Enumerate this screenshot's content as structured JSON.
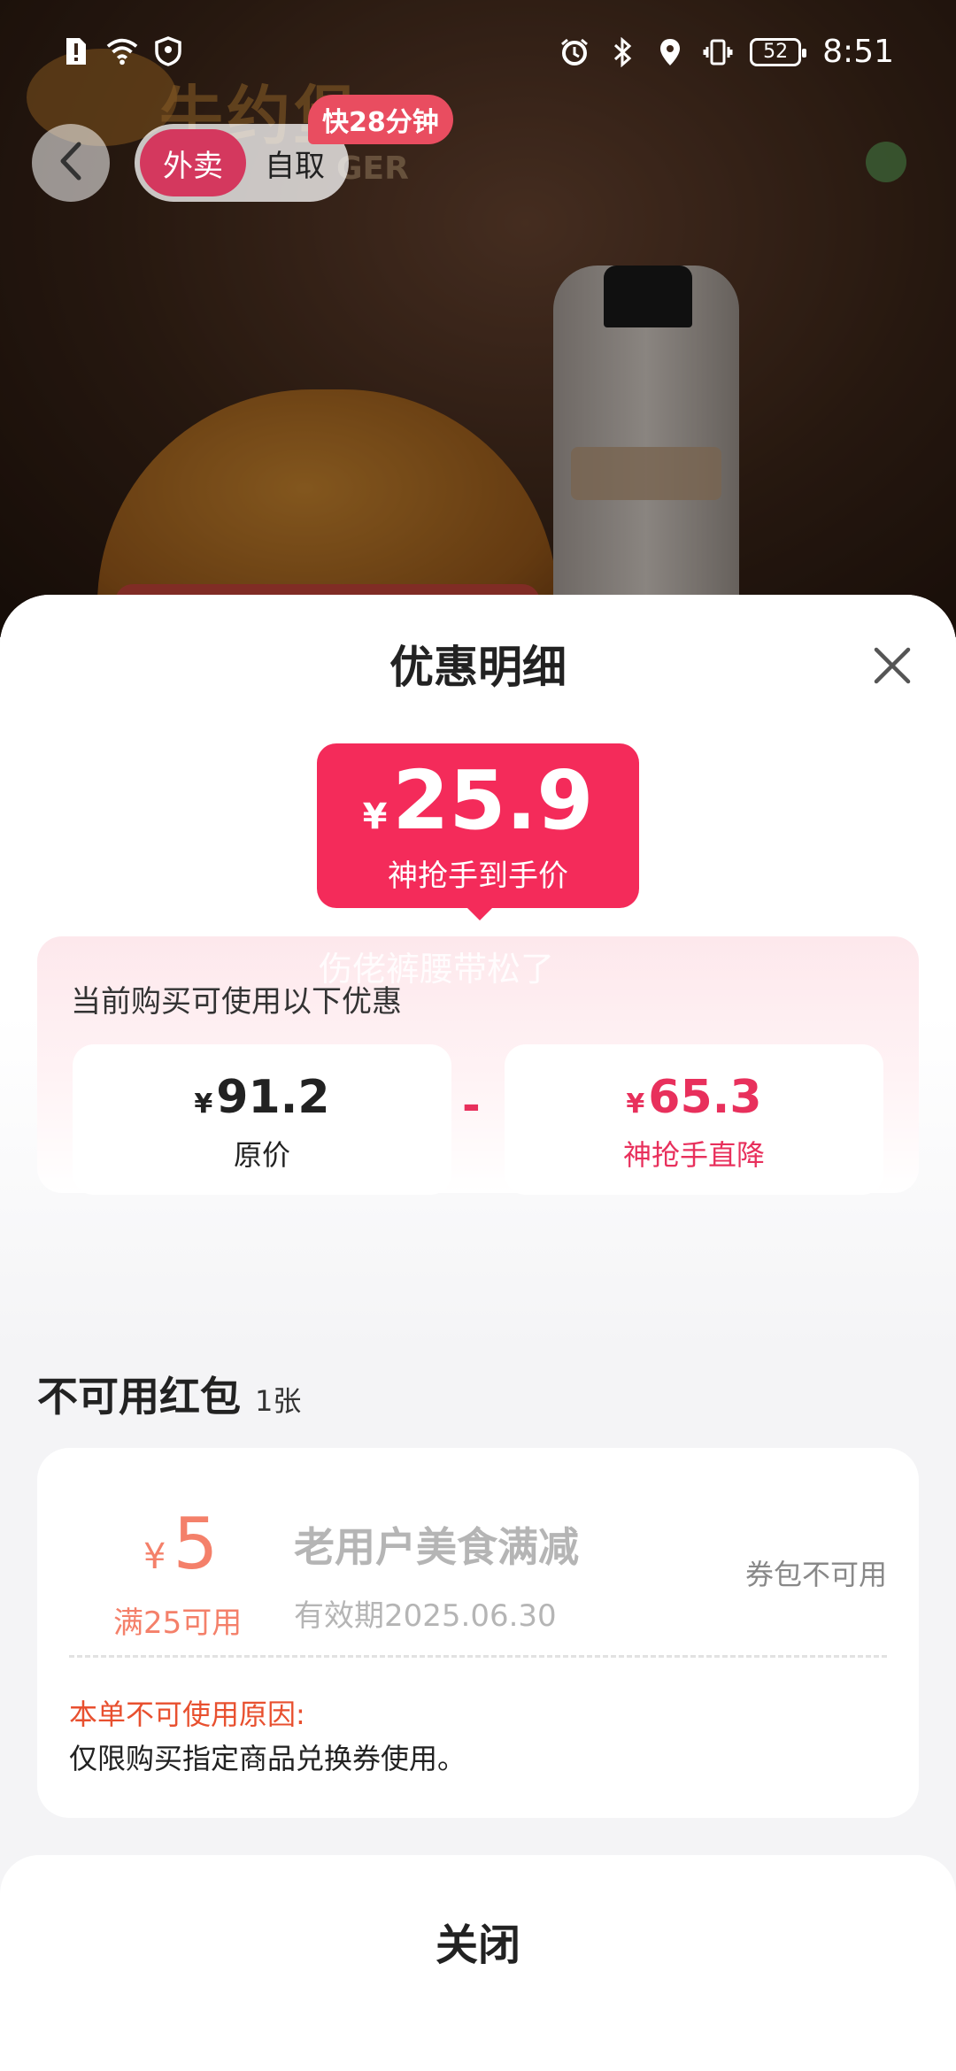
{
  "status_bar": {
    "battery": "52",
    "time": "8:51"
  },
  "store": {
    "brand_name": "牛约堡",
    "brand_sub": "GER",
    "delivery_badge": "快28分钟"
  },
  "order_mode": {
    "active": "外卖",
    "inactive": "自取"
  },
  "sheet": {
    "title": "优惠明细",
    "final_price": {
      "currency": "¥",
      "amount": "25.9",
      "label": "神抢手到手价"
    },
    "watermark": "伤佬裤腰带松了",
    "caption": "当前购买可使用以下优惠",
    "original": {
      "currency": "¥",
      "amount": "91.2",
      "label": "原价"
    },
    "operator": "-",
    "discount": {
      "currency": "¥",
      "amount": "65.3",
      "label": "神抢手直降"
    }
  },
  "unusable": {
    "title": "不可用红包",
    "count": "1张",
    "coupon": {
      "currency": "¥",
      "amount": "5",
      "min_spend": "满25可用",
      "name": "老用户美食满减",
      "expiry": "有效期2025.06.30",
      "status": "券包不可用",
      "reason_title": "本单不可使用原因:",
      "reason": "仅限购买指定商品兑换券使用。"
    }
  },
  "footer": {
    "close_label": "关闭"
  },
  "colors": {
    "primary_red": "#f42b5a",
    "discount_red": "#e8305c",
    "coupon_orange": "#f4806a",
    "reason_orange": "#e8502f",
    "toggle_active": "#d4385e",
    "badge_red": "#e94d60"
  },
  "icons": [
    "sim-alert-icon",
    "wifi-icon",
    "vpn-shield-icon",
    "alarm-icon",
    "bluetooth-icon",
    "location-icon",
    "vibrate-icon",
    "battery-icon",
    "back-arrow-icon",
    "close-icon",
    "share-icon"
  ]
}
